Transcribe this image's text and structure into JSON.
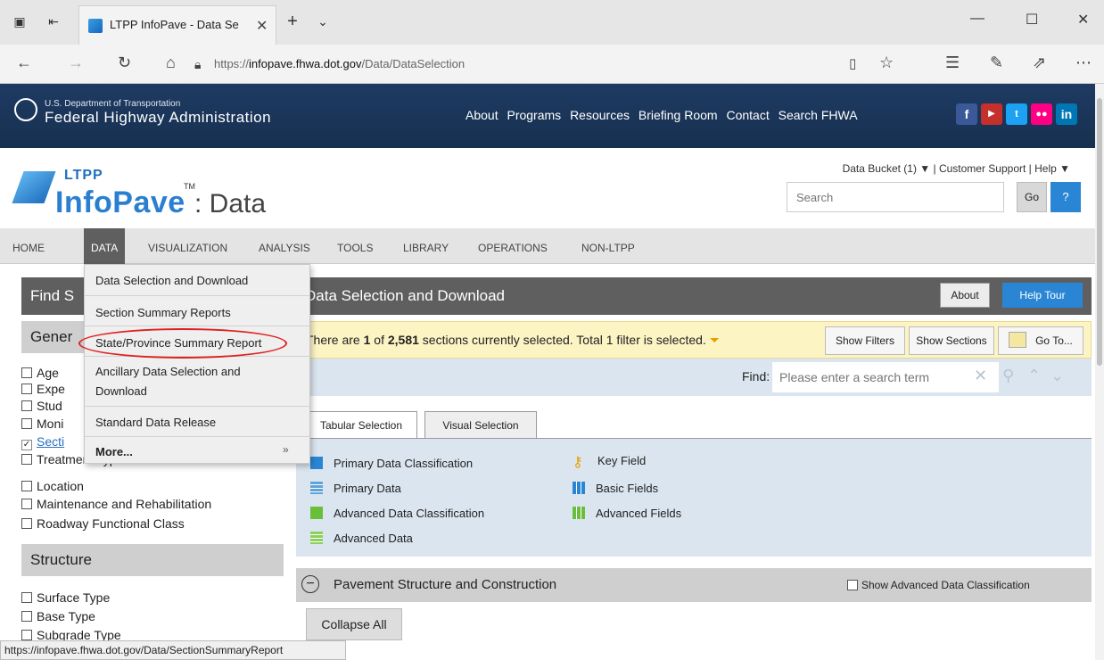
{
  "browser": {
    "tab_title": "LTPP InfoPave - Data Se",
    "url_prefix": "https://",
    "url_domain": "infopave.fhwa.dot.gov",
    "url_path": "/Data/DataSelection",
    "status_url": "https://infopave.fhwa.dot.gov/Data/SectionSummaryReport"
  },
  "fhwa": {
    "dept": "U.S. Department of Transportation",
    "name": "Federal Highway Administration",
    "nav": [
      "About",
      "Programs",
      "Resources",
      "Briefing Room",
      "Contact",
      "Search FHWA"
    ]
  },
  "header": {
    "ltpp": "LTPP",
    "infopave": "InfoPave",
    "tm": "TM",
    "data": ": Data",
    "top_links": "Data Bucket (1) ▼  |  Customer Support  |  Help ▼",
    "search_placeholder": "Search",
    "go": "Go",
    "help": "?"
  },
  "mainnav": [
    "HOME",
    "DATA",
    "VISUALIZATION",
    "ANALYSIS",
    "TOOLS",
    "LIBRARY",
    "OPERATIONS",
    "NON-LTPP"
  ],
  "dropdown": {
    "items": [
      "Data Selection and Download",
      "Section Summary Reports",
      "State/Province Summary Report",
      "Ancillary Data Selection and",
      "Download",
      "Standard Data Release",
      "More..."
    ]
  },
  "sidebar": {
    "find_head": "Find S",
    "gen_head": "Gener",
    "general": [
      "Age",
      "Expe",
      "Stud",
      "Moni",
      "Secti",
      "Treatment Type",
      "Location",
      "Maintenance and Rehabilitation",
      "Roadway Functional Class"
    ],
    "structure_head": "Structure",
    "structure": [
      "Surface Type",
      "Base Type",
      "Subgrade Type"
    ]
  },
  "main": {
    "title": "Data Selection and Download",
    "about": "About",
    "help_tour": "Help Tour",
    "sel_pre": "There are ",
    "sel_count": "1",
    "sel_mid": " of ",
    "sel_total": "2,581",
    "sel_post": " sections currently selected. Total 1 filter is selected.",
    "show_filters": "Show Filters",
    "show_sections": "Show Sections",
    "goto": "Go To...",
    "find_label": "Find:",
    "find_placeholder": "Please enter a search term",
    "tab_tabular": "Tabular Selection",
    "tab_visual": "Visual Selection",
    "legend": [
      "Primary Data Classification",
      "Primary Data",
      "Advanced Data Classification",
      "Advanced Data",
      "Key Field",
      "Basic Fields",
      "Advanced Fields"
    ],
    "pav_head": "Pavement Structure and Construction",
    "show_adv": "Show Advanced Data Classification",
    "collapse_all": "Collapse All"
  }
}
